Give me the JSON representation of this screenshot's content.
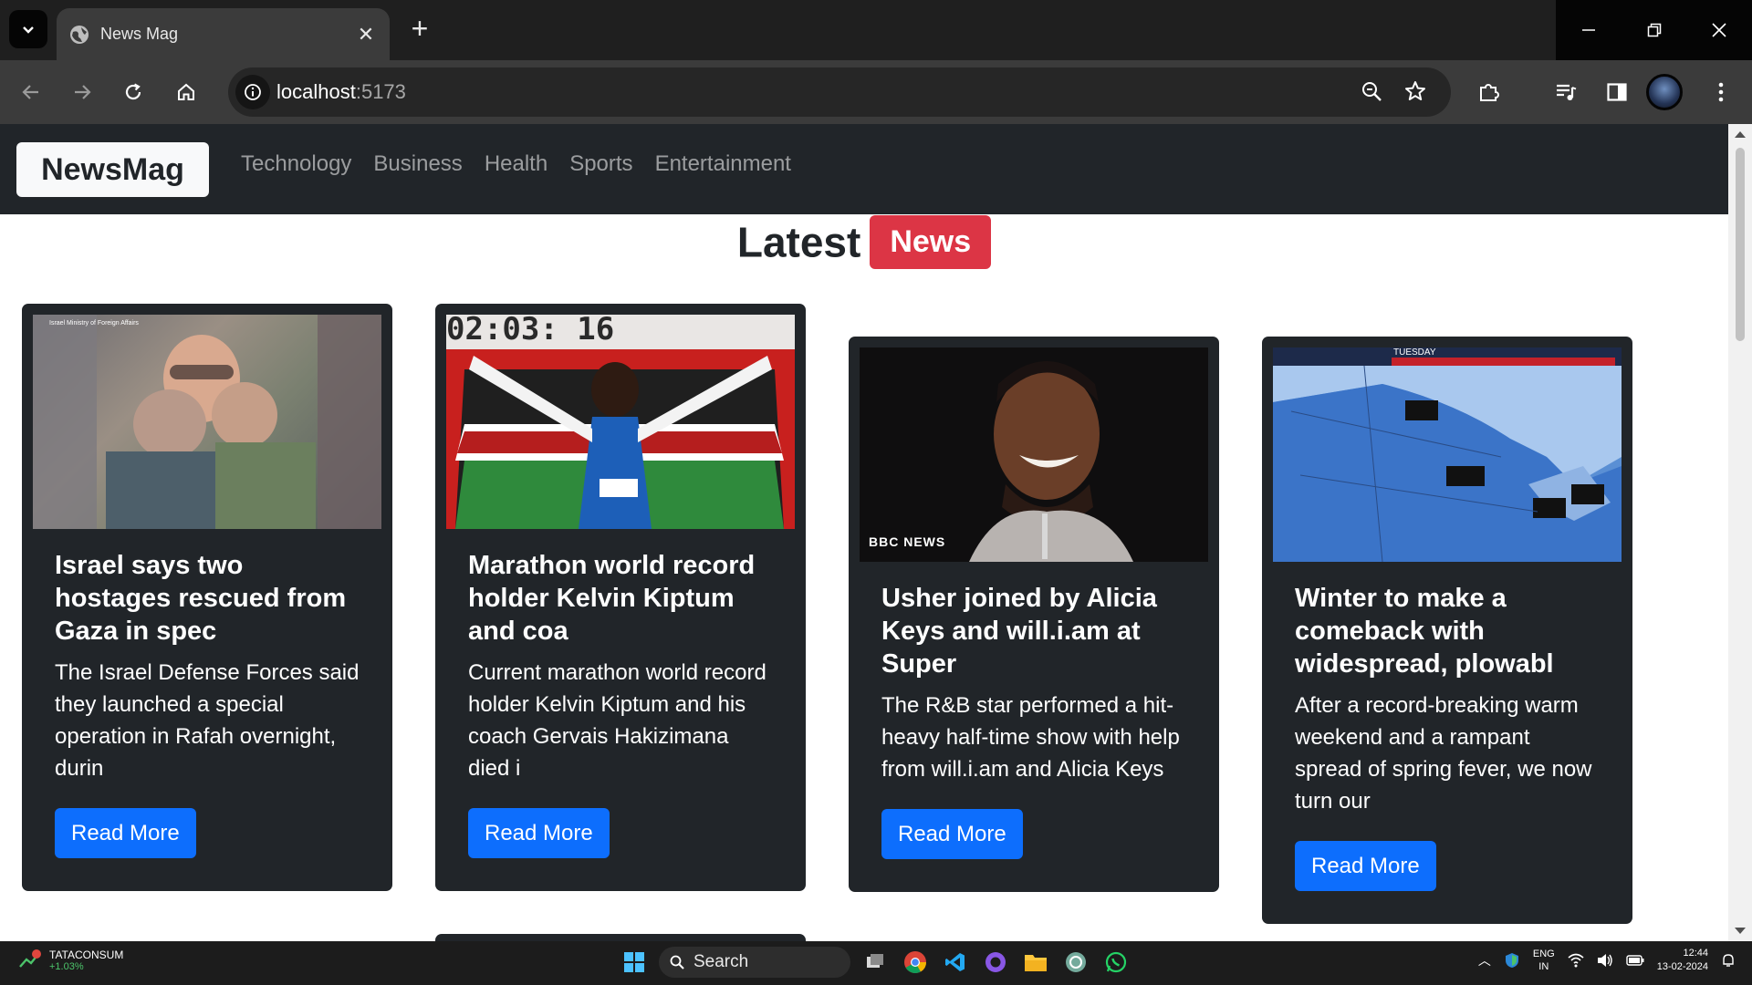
{
  "browser": {
    "tab_title": "News Mag",
    "url_host": "localhost",
    "url_port": ":5173"
  },
  "site": {
    "brand": "NewsMag",
    "nav": [
      "Technology",
      "Business",
      "Health",
      "Sports",
      "Entertainment"
    ],
    "heading": "Latest",
    "heading_badge": "News"
  },
  "articles": [
    {
      "title": "Israel says two hostages rescued from Gaza in spec",
      "description": "The Israel Defense Forces said they launched a special operation in Rafah overnight, durin",
      "button": "Read More",
      "image_caption": "Israel Ministry of Foreign Affairs"
    },
    {
      "title": "Marathon world record holder Kelvin Kiptum and coa",
      "description": "Current marathon world record holder Kelvin Kiptum and his coach Gervais Hakizimana died i",
      "button": "Read More",
      "image_caption": "02:03: 16"
    },
    {
      "title": "Usher joined by Alicia Keys and will.i.am at Super",
      "description": "The R&B star performed a hit-heavy half-time show with help from will.i.am and Alicia Keys",
      "button": "Read More",
      "image_caption": "BBC NEWS"
    },
    {
      "title": "Winter to make a comeback with widespread, plowabl",
      "description": "After a record-breaking warm weekend and a rampant spread of spring fever, we now turn our",
      "button": "Read More",
      "image_caption": "TUESDAY"
    }
  ],
  "taskbar": {
    "stock_name": "TATACONSUM",
    "stock_change": "+1.03%",
    "search": "Search",
    "lang_line1": "ENG",
    "lang_line2": "IN",
    "time": "12:44",
    "date": "13-02-2024"
  }
}
